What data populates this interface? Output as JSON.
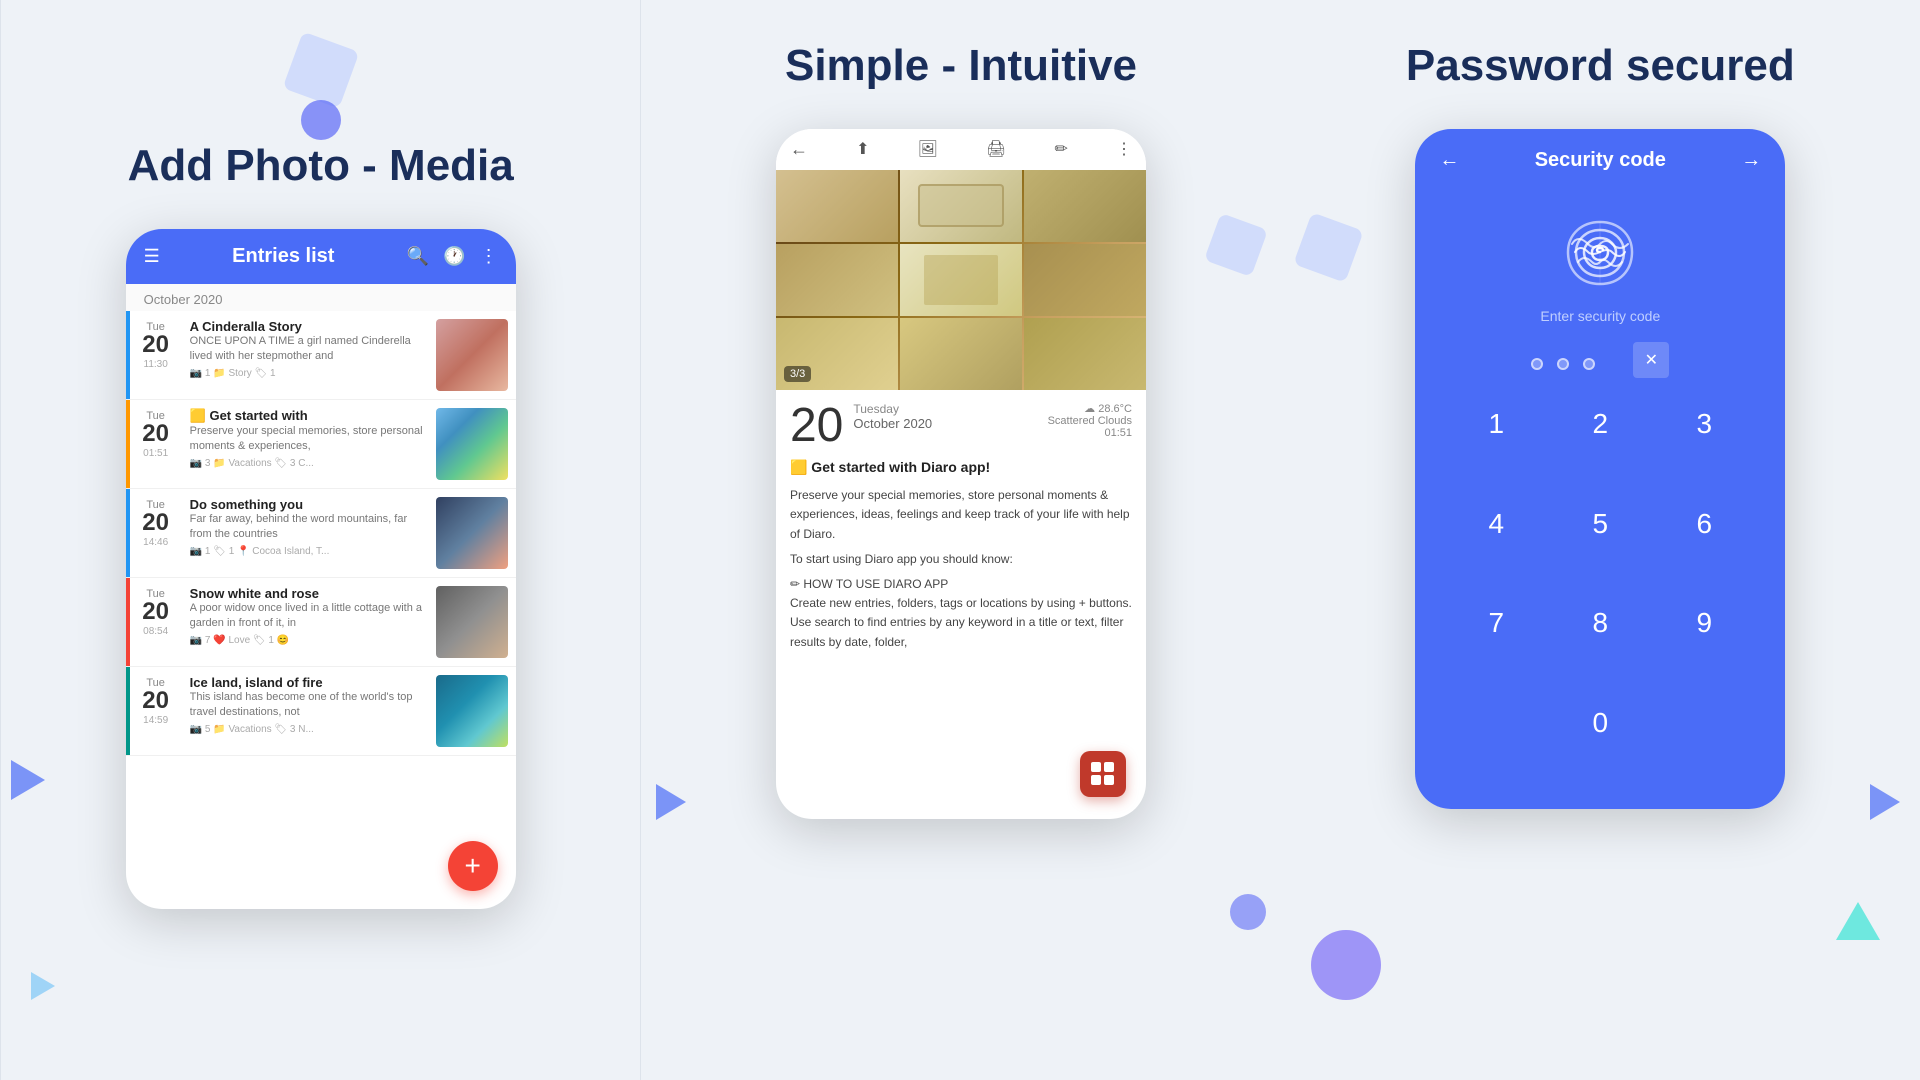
{
  "panel1": {
    "title": "Add Photo - Media",
    "app_header": {
      "title": "Entries list"
    },
    "month_label": "October 2020",
    "entries": [
      {
        "day_label": "Tue",
        "day_num": "20",
        "time": "11:30",
        "bar_color": "bar-blue",
        "title": "A Cinderalla Story",
        "snippet": "ONCE UPON A TIME a girl named Cinderella lived with her stepmother and",
        "meta": "📷 1  📁 Story  🏷 1",
        "has_thumb": true,
        "thumb_type": "img-girl"
      },
      {
        "day_label": "Tue",
        "day_num": "20",
        "time": "01:51",
        "bar_color": "bar-orange",
        "title": "🟨 Get started with",
        "snippet": "Preserve your special memories, store personal moments & experiences,",
        "meta": "📷 3  📁 Vacations  🏷 3  C...",
        "has_thumb": true,
        "thumb_type": "img-beach"
      },
      {
        "day_label": "Tue",
        "day_num": "20",
        "time": "14:46",
        "bar_color": "bar-blue",
        "title": "Do something you",
        "snippet": "Far far away, behind the word mountains, far from the countries",
        "meta": "📷 1  🏷 1  📍 Cocoa Island, T...",
        "has_thumb": true,
        "thumb_type": "img-girl2"
      },
      {
        "day_label": "Tue",
        "day_num": "20",
        "time": "08:54",
        "bar_color": "bar-red",
        "title": "Snow white and rose",
        "snippet": "A poor widow once lived in a little cottage with a garden in front of it, in",
        "meta": "📷 7  ❤️ Love  🏷 1  😊",
        "has_thumb": true,
        "thumb_type": "img-woman"
      },
      {
        "day_label": "Tue",
        "day_num": "20",
        "time": "14:59",
        "bar_color": "bar-teal",
        "title": "Ice land, island of fire",
        "snippet": "This island has become one of the world's top travel destinations, not",
        "meta": "📷 5  📁 Vacations  🏷 3  N...",
        "has_thumb": true,
        "thumb_type": "img-falls"
      }
    ],
    "fab_label": "+"
  },
  "panel2": {
    "title": "Simple - Intuitive",
    "image_counter": "3/3",
    "date_num": "20",
    "weekday": "Tuesday",
    "month_year": "October 2020",
    "weather": "☁ 28.6°C",
    "weather_desc": "Scattered Clouds",
    "time": "01:51",
    "entry_title": "🟨 Get started with Diaro app!",
    "body_lines": [
      "Preserve your special memories, store personal moments & experiences, ideas, feelings and keep track of your life with help of Diaro.",
      "To start using Diaro app you should know:",
      "",
      "✏ HOW TO USE DIARO APP",
      "Create new entries, folders, tags or locations by using + buttons.",
      "Use search to find entries by any keyword in a title or text, filter results by date, folder,"
    ]
  },
  "panel3": {
    "title": "Password secured",
    "header_title": "Security code",
    "subtitle": "Enter security code",
    "numpad": [
      "1",
      "2",
      "3",
      "4",
      "5",
      "6",
      "7",
      "8",
      "9",
      "0"
    ],
    "nav_back": "←",
    "nav_forward": "→"
  }
}
